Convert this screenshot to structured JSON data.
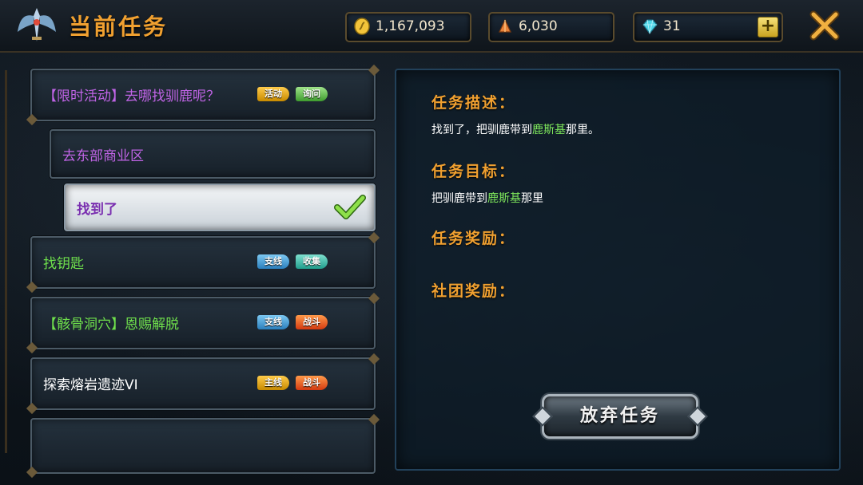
{
  "header": {
    "title": "当前任务",
    "gold": "1,167,093",
    "crystal": "6,030",
    "gems": "31",
    "plus_label": "+"
  },
  "quests": [
    {
      "label": "【限时活动】去哪找驯鹿呢？",
      "color": "#c064e6",
      "tags": [
        {
          "text": "活动",
          "style": "orange"
        },
        {
          "text": "询问",
          "style": "green"
        }
      ]
    },
    {
      "label": "去东部商业区",
      "color": "#c064e6",
      "tags": []
    },
    {
      "label": "找到了",
      "color": "#7a2fb0",
      "selected": true,
      "tags": []
    },
    {
      "label": "找钥匙",
      "color": "#6fe04c",
      "tags": [
        {
          "text": "支线",
          "style": "blue"
        },
        {
          "text": "收集",
          "style": "teal"
        }
      ]
    },
    {
      "label": "【骸骨洞穴】恩赐解脱",
      "color": "#6fe04c",
      "tags": [
        {
          "text": "支线",
          "style": "blue"
        },
        {
          "text": "战斗",
          "style": "red"
        }
      ]
    },
    {
      "label": "探索熔岩遗迹VI",
      "color": "#ffffff",
      "tags": [
        {
          "text": "主线",
          "style": "orange"
        },
        {
          "text": "战斗",
          "style": "red"
        }
      ]
    },
    {
      "label": "",
      "color": "#ffffff",
      "tags": []
    }
  ],
  "detail": {
    "desc_heading": "任务描述：",
    "desc_pre": "找到了，把驯鹿带到",
    "desc_highlight": "鹿斯基",
    "desc_post": "那里。",
    "goal_heading": "任务目标：",
    "goal_pre": "把驯鹿带到",
    "goal_highlight": "鹿斯基",
    "goal_post": "那里",
    "reward_heading": "任务奖励：",
    "guild_reward_heading": "社团奖励：",
    "abandon_label": "放弃任务"
  }
}
